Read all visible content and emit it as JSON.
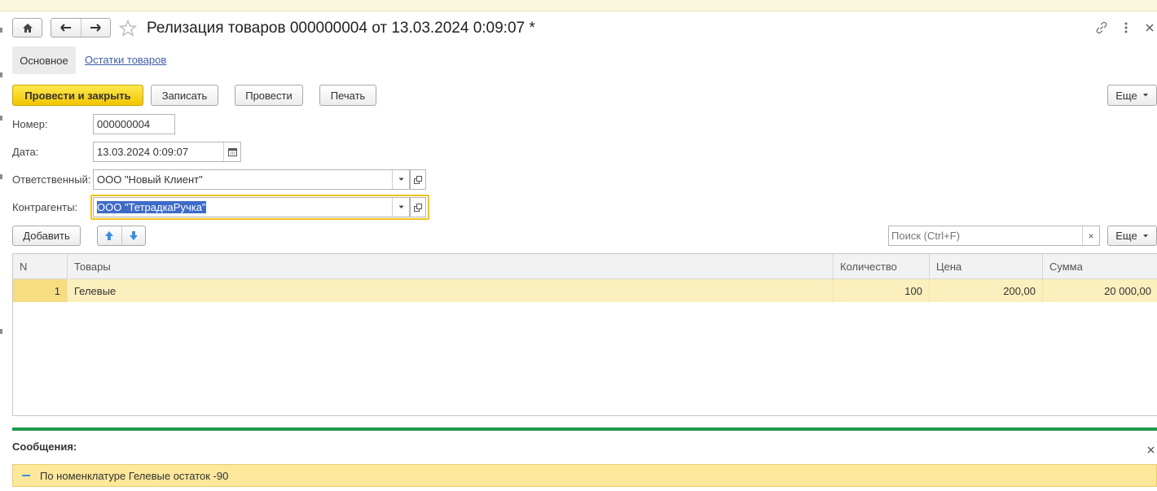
{
  "window": {
    "title": "Релизация товаров 000000004 от 13.03.2024 0:09:07 *"
  },
  "tabs": [
    {
      "label": "Основное",
      "active": true
    },
    {
      "label": "Остатки товаров",
      "active": false
    }
  ],
  "toolbar": {
    "post_and_close": "Провести и закрыть",
    "save": "Записать",
    "post": "Провести",
    "print": "Печать",
    "more": "Еще"
  },
  "form": {
    "number_label": "Номер:",
    "number_value": "000000004",
    "date_label": "Дата:",
    "date_value": "13.03.2024  0:09:07",
    "responsible_label": "Ответственный:",
    "responsible_value": "ООО \"Новый Клиент\"",
    "counterparty_label": "Контрагенты:",
    "counterparty_value": "ООО \"ТетрадкаРучка\""
  },
  "table_toolbar": {
    "add": "Добавить",
    "search_placeholder": "Поиск (Ctrl+F)",
    "clear": "×",
    "more": "Еще"
  },
  "table": {
    "columns": [
      "N",
      "Товары",
      "Количество",
      "Цена",
      "Сумма"
    ],
    "rows": [
      {
        "n": "1",
        "product": "Гелевые",
        "qty": "100",
        "price": "200,00",
        "sum": "20 000,00"
      }
    ]
  },
  "messages": {
    "title": "Сообщения:",
    "close": "×",
    "items": [
      {
        "text": "По номенклатуре Гелевые остаток -90"
      }
    ]
  },
  "colors": {
    "primary_button": "#f6d10f",
    "selected_row": "#fcefbe",
    "message_bar": "#fce79a",
    "separator": "#1e9a4c",
    "link": "#3f5ea8",
    "focus_border": "#f0c419"
  },
  "icons": [
    "home-icon",
    "arrow-left-icon",
    "arrow-right-icon",
    "star-icon",
    "link-icon",
    "more-vert-icon",
    "close-icon",
    "calendar-icon",
    "dropdown-icon",
    "open-icon",
    "arrow-up-icon",
    "arrow-down-icon"
  ]
}
